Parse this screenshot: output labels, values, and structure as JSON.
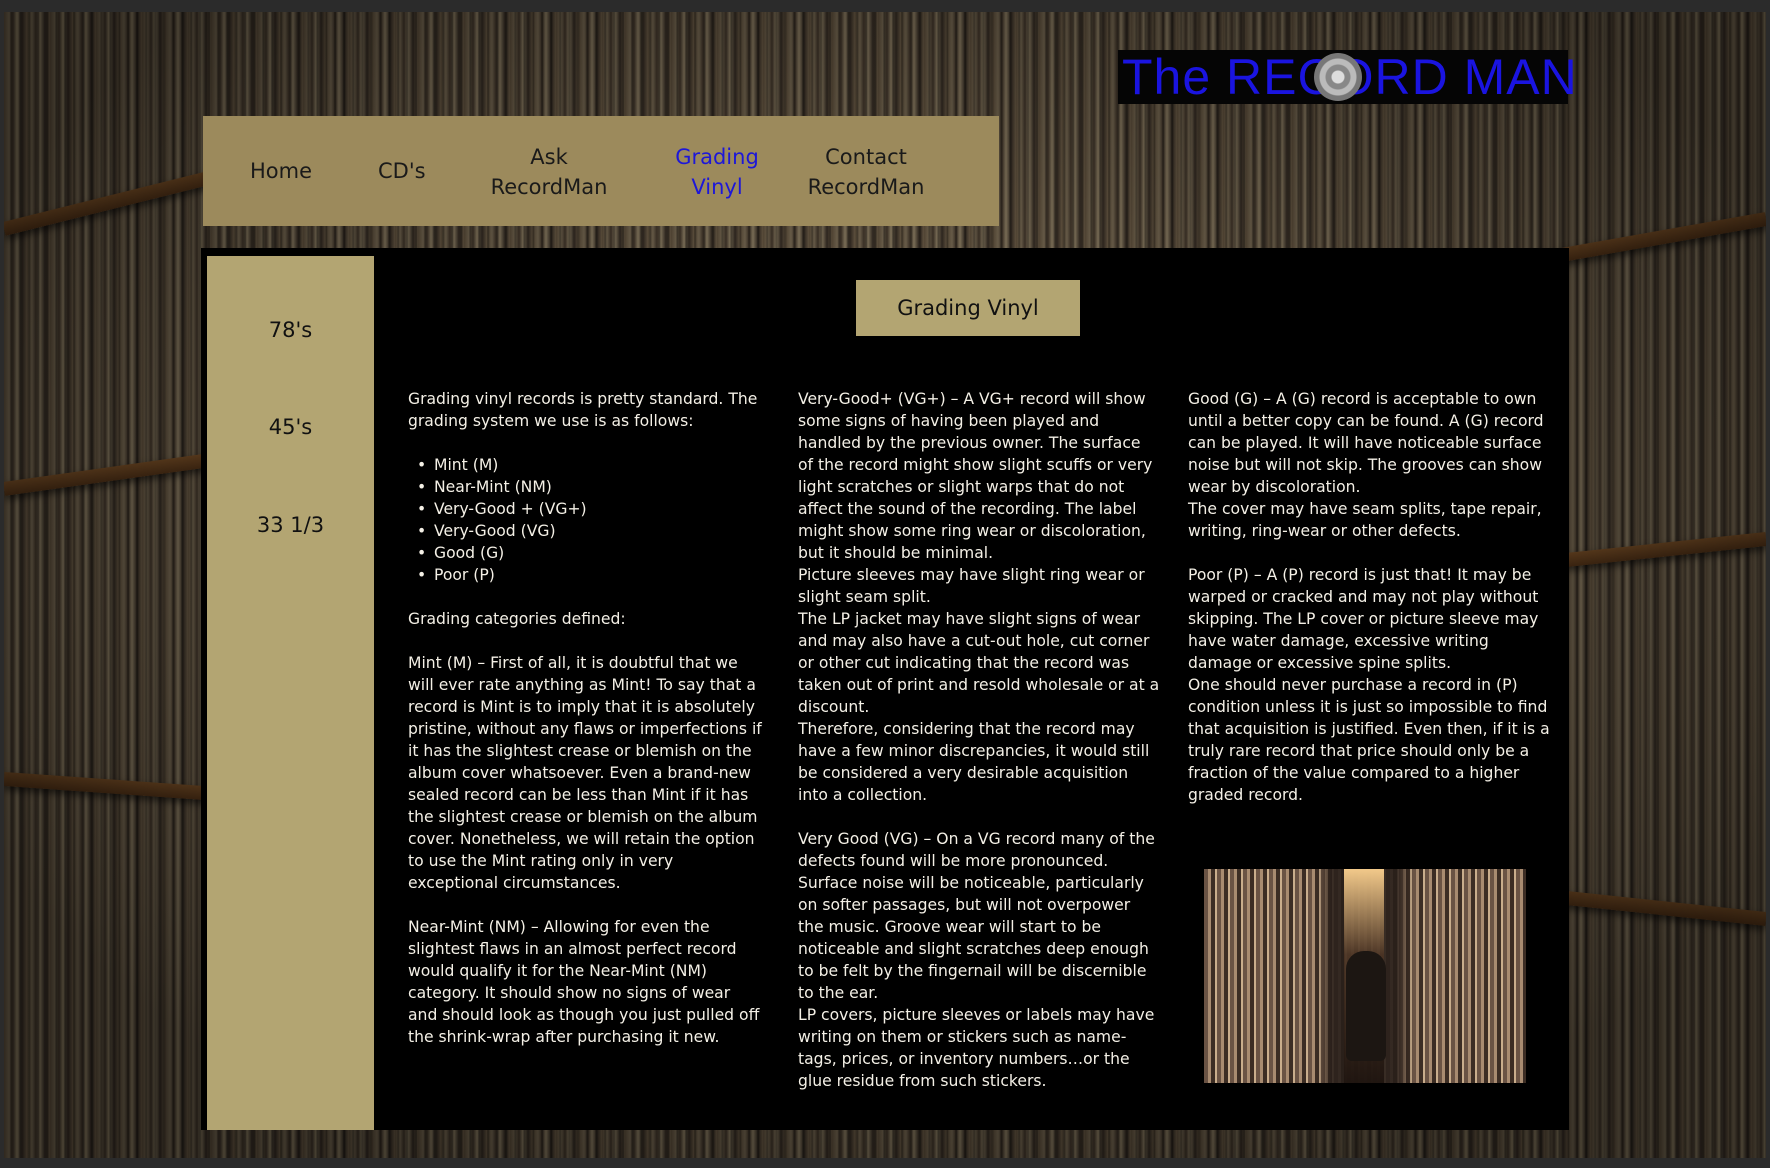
{
  "logo": {
    "text": "The RECORD MAN"
  },
  "nav": {
    "items": [
      {
        "label": "Home"
      },
      {
        "label": "CD's"
      },
      {
        "label_line1": "Ask",
        "label_line2": "RecordMan"
      },
      {
        "label_line1": "Grading",
        "label_line2": "Vinyl"
      },
      {
        "label_line1": "Contact",
        "label_line2": "RecordMan"
      }
    ],
    "active_color": "#1d17d8",
    "background_color": "#9c8a5c"
  },
  "sidebar": {
    "items": [
      "78's",
      "45's",
      "33 1/3"
    ],
    "background_color": "#b3a572"
  },
  "page_title": "Grading Vinyl",
  "col1": {
    "intro": "Grading vinyl records is pretty standard.  The grading system we use is as follows:",
    "grades": [
      "Mint  (M)",
      "Near-Mint (NM)",
      "Very-Good + (VG+)",
      "Very-Good (VG)",
      "Good (G)",
      "Poor (P)"
    ],
    "categories_heading": "Grading categories defined:",
    "mint": "Mint (M) – First of all, it is doubtful that we will ever rate anything as Mint!  To say that a record is Mint is to imply that it is absolutely pristine, without any flaws or imperfections if it has the slightest crease or blemish on the album cover whatsoever.  Even a brand-new sealed record can be less than Mint if it has the slightest crease or blemish on the album cover.  Nonetheless, we will retain the option to use the Mint rating only in very exceptional circumstances.",
    "near_mint": "Near-Mint (NM) – Allowing for even the slightest flaws in an almost perfect record would qualify it for the Near-Mint (NM) category.  It should show no signs of wear and should look as though you just pulled off the shrink-wrap after purchasing it new."
  },
  "col2": {
    "vg_plus": "Very-Good+ (VG+) – A VG+ record will show some signs of having been played and handled by the previous owner.  The surface of the record might show slight scuffs or very light scratches or slight warps that do not affect the sound of the recording.  The label might show some ring wear or discoloration, but it should be minimal.",
    "vg_plus_sleeves": "Picture sleeves may have slight ring wear or slight seam split.",
    "vg_plus_jacket": "The LP jacket may have slight signs of wear and may also have a cut-out hole, cut corner or other cut indicating that the record was taken out of print and resold wholesale or at a discount.",
    "vg_plus_therefore": "Therefore, considering that the record may have a few minor discrepancies, it would still be considered a very desirable acquisition into a collection.",
    "vg": "Very Good (VG) – On a VG record many of the defects found will be more pronounced.  Surface noise will be noticeable, particularly on softer passages, but will not overpower the music.  Groove wear will start to be noticeable and slight scratches deep enough to be felt by the fingernail will be discernible to the ear.",
    "vg_covers": "LP covers, picture sleeves or labels may have writing on them or stickers such as name-tags, prices, or inventory numbers…or the glue residue from such stickers."
  },
  "col3": {
    "good": "Good (G) – A (G) record is acceptable to own until a better copy can be found.  A (G) record can be played.  It will have noticeable surface noise but will not skip.  The grooves can show wear by discoloration.",
    "good_cover": "The cover may have seam splits, tape repair, writing, ring-wear or other defects.",
    "poor": "Poor (P) – A (P) record is just that!  It may be warped or cracked and may not play without skipping.  The LP cover or picture sleeve may have water damage, excessive writing damage or excessive spine splits.",
    "poor_advice": "One should never purchase a record in (P) condition unless it is just so impossible to find that acquisition is justified.  Even then, if it is a truly rare record that price should only be a fraction of the value compared to a higher graded record."
  }
}
